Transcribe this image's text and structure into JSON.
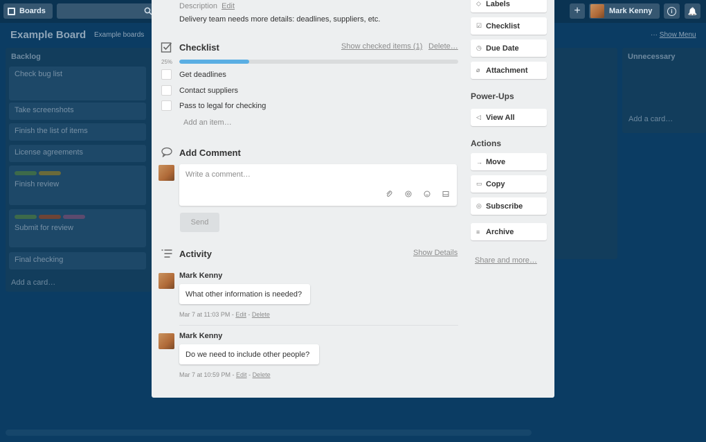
{
  "topbar": {
    "boards_label": "Boards",
    "user_name": "Mark Kenny",
    "add_symbol": "+",
    "info_symbol": "i",
    "bell_symbol": "🔔"
  },
  "board": {
    "title": "Example Board",
    "subtitle": "Example boards",
    "show_menu": "Show Menu",
    "menu_dots": "···"
  },
  "lists": {
    "backlog": {
      "title": "Backlog",
      "cards": [
        "Check bug list",
        "Take screenshots",
        "Finish the list of items",
        "License agreements",
        "Finish review",
        "Submit for review",
        "Final checking"
      ],
      "add_card": "Add a card…"
    },
    "unnecessary": {
      "title": "Unnecessary",
      "add_card": "Add a card…"
    }
  },
  "card": {
    "description_label": "Description",
    "description_edit": "Edit",
    "description_text": "Delivery team needs more details: deadlines, suppliers, etc.",
    "checklist": {
      "title": "Checklist",
      "show_checked": "Show checked items (1)",
      "delete": "Delete…",
      "progress_text": "25%",
      "progress": 0.25,
      "items": [
        "Get deadlines",
        "Contact suppliers",
        "Pass to legal for checking"
      ],
      "add_item": "Add an item…"
    },
    "comment": {
      "title": "Add Comment",
      "placeholder": "Write a comment…",
      "send": "Send"
    },
    "activity": {
      "title": "Activity",
      "show_details": "Show Details",
      "entries": [
        {
          "author": "Mark Kenny",
          "text": "What other information is needed?",
          "time": "Mar 7 at 11:03 PM",
          "edit": "Edit",
          "delete": "Delete"
        },
        {
          "author": "Mark Kenny",
          "text": "Do we need to include other people?",
          "time": "Mar 7 at 10:59 PM",
          "edit": "Edit",
          "delete": "Delete"
        }
      ]
    }
  },
  "sidebar": {
    "add_buttons": [
      "Labels",
      "Checklist",
      "Due Date",
      "Attachment"
    ],
    "powerups_title": "Power-Ups",
    "view_all": "View All",
    "actions_title": "Actions",
    "actions": [
      "Move",
      "Copy",
      "Subscribe",
      "Archive"
    ],
    "share": "Share and more…"
  },
  "colors": {
    "accent": "#5aaee3",
    "label_green": "#61bd4f",
    "label_yellow": "#f2d600",
    "label_orange": "#ff9f1a",
    "label_red": "#eb5a46",
    "label_purple": "#c377e0"
  }
}
